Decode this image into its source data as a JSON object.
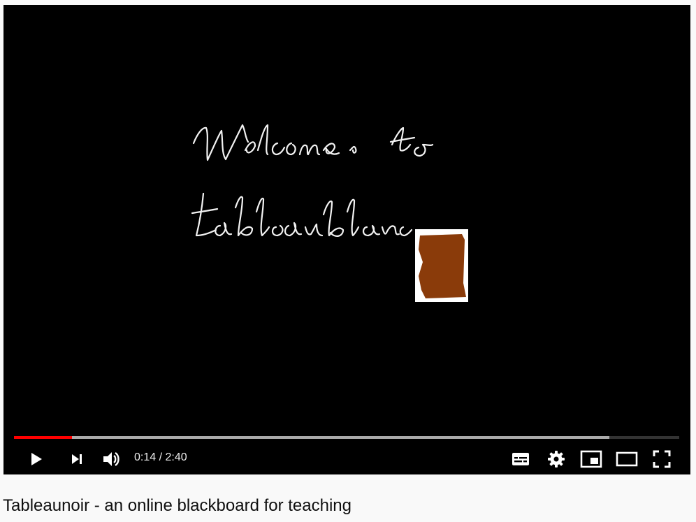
{
  "video": {
    "handwriting_lines": [
      "Welcome to",
      "tableau blanc"
    ],
    "eraser_color": "#8a3b0a"
  },
  "player": {
    "progress_fraction": 0.0875,
    "buffered_fraction": 0.895,
    "progress_color": "#ff0000",
    "time_current": "0:14",
    "time_separator": "/",
    "time_duration": "2:40",
    "icons": [
      "play-icon",
      "next-icon",
      "volume-icon",
      "subtitles-icon",
      "settings-icon",
      "miniplayer-icon",
      "theater-mode-icon",
      "fullscreen-icon"
    ]
  },
  "title": "Tableaunoir - an online blackboard for teaching",
  "colors": {
    "page_bg": "#f9f9f9",
    "player_bg": "#000000",
    "title_text": "#0f0f0f"
  }
}
